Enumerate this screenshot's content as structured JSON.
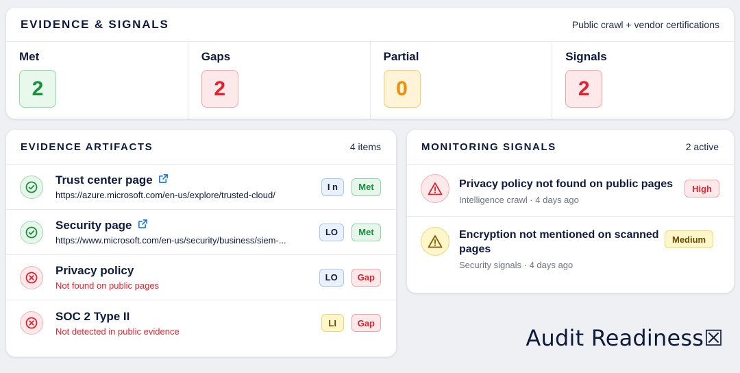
{
  "summary": {
    "title": "EVIDENCE & SIGNALS",
    "subtitle": "Public crawl + vendor certifications",
    "stats": [
      {
        "label": "Met",
        "value": "2",
        "tone": "green"
      },
      {
        "label": "Gaps",
        "value": "2",
        "tone": "red"
      },
      {
        "label": "Partial",
        "value": "0",
        "tone": "orange"
      },
      {
        "label": "Signals",
        "value": "2",
        "tone": "red"
      }
    ]
  },
  "artifacts": {
    "title": "EVIDENCE ARTIFACTS",
    "count": "4 items",
    "items": [
      {
        "title": "Trust center page",
        "sub": "https://azure.microsoft.com/en-us/explore/trusted-cloud/",
        "status": "met",
        "level": "I n",
        "state": "Met",
        "external_link_icon": "external-link-icon",
        "status_icon": "check-circle-icon"
      },
      {
        "title": "Security page",
        "sub": "https://www.microsoft.com/en-us/security/business/siem-...",
        "status": "met",
        "level": "LO",
        "state": "Met",
        "external_link_icon": "external-link-icon",
        "status_icon": "check-circle-icon"
      },
      {
        "title": "Privacy policy",
        "sub": "Not found on public pages",
        "status": "gap",
        "level": "LO",
        "state": "Gap",
        "status_icon": "x-circle-icon"
      },
      {
        "title": "SOC 2 Type II",
        "sub": "Not detected in public evidence",
        "status": "gap",
        "level": "LI",
        "state": "Gap",
        "status_icon": "x-circle-icon"
      }
    ]
  },
  "monitoring": {
    "title": "MONITORING SIGNALS",
    "count": "2 active",
    "items": [
      {
        "title": "Privacy policy not found on public pages",
        "meta": "Intelligence crawl · 4 days ago",
        "severity": "High",
        "icon": "warning-triangle-icon"
      },
      {
        "title": "Encryption not mentioned on scanned pages",
        "meta": "Security signals · 4 days ago",
        "severity": "Medium",
        "icon": "warning-triangle-icon"
      }
    ]
  },
  "watermark": "Audit Readiness☒",
  "colors": {
    "navy": "#0f1b3d",
    "green": "#17913b",
    "red": "#e0232e",
    "orange": "#f08c00",
    "link_blue": "#1f7ae0"
  }
}
